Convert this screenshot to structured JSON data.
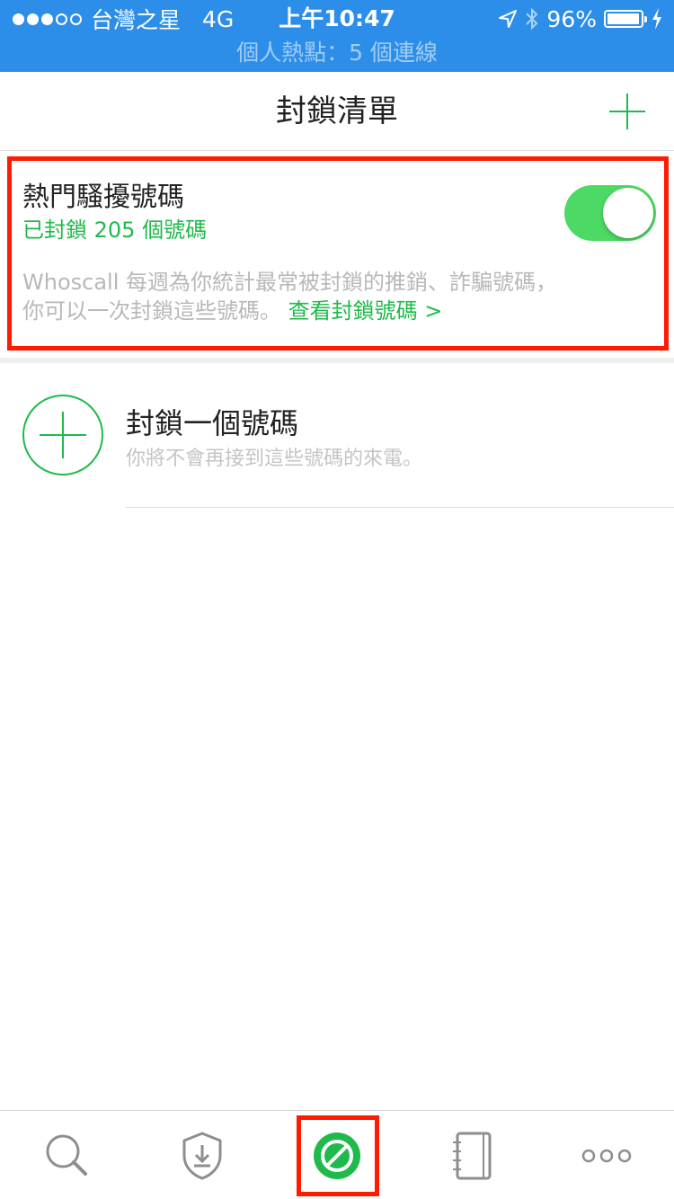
{
  "status_bar": {
    "carrier": "台灣之星",
    "network": "4G",
    "time": "上午10:47",
    "battery": "96%",
    "battery_level": 0.96,
    "hotspot": "個人熱點：5 個連線"
  },
  "nav": {
    "title": "封鎖清單"
  },
  "hot_spam": {
    "title": "熱門騷擾號碼",
    "subtitle": "已封鎖 205 個號碼",
    "toggle_on": true,
    "description": "Whoscall 每週為你統計最常被封鎖的推銷、詐騙號碼，你可以一次封鎖這些號碼。",
    "link": "查看封鎖號碼 >"
  },
  "block_number": {
    "title": "封鎖一個號碼",
    "subtitle": "你將不會再接到這些號碼的來電。"
  },
  "tabs": [
    {
      "icon": "search-icon"
    },
    {
      "icon": "shield-download-icon"
    },
    {
      "icon": "block-icon",
      "active": true
    },
    {
      "icon": "notebook-icon"
    },
    {
      "icon": "more-icon"
    }
  ],
  "colors": {
    "status_bar": "#2d8ee9",
    "accent_green": "#1fba4b",
    "toggle_green": "#4cd964",
    "highlight_red": "#ff1a00"
  }
}
